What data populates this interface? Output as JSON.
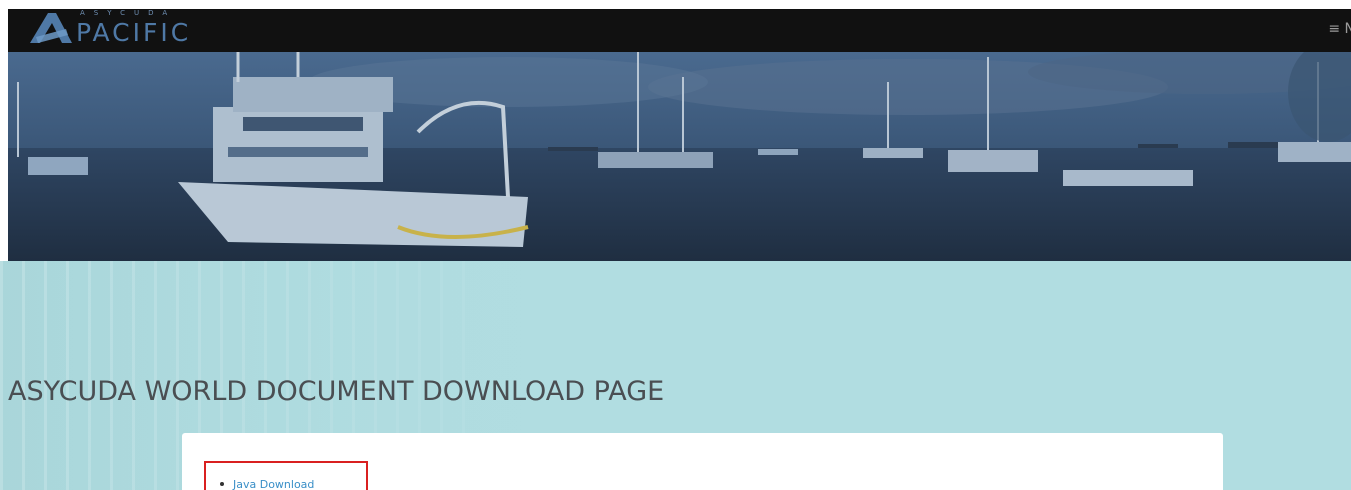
{
  "header": {
    "logo_small": "ASYCUDA",
    "logo_text": "PACIFIC",
    "menu_label": "≡ N"
  },
  "hero": {
    "image_alt": "Boats moored in a harbour"
  },
  "main": {
    "title": "ASYCUDA WORLD DOCUMENT DOWNLOAD PAGE",
    "downloads": [
      {
        "label": "Java Download"
      }
    ]
  },
  "colors": {
    "navbar": "#111111",
    "logo": "#4f79a6",
    "content_bg": "#b1dde1",
    "title": "#4a4e52",
    "link": "#3a8fc7",
    "highlight": "#d92020"
  },
  "icons": {
    "menu": "hamburger-icon",
    "logo": "asycuda-logo-icon"
  }
}
